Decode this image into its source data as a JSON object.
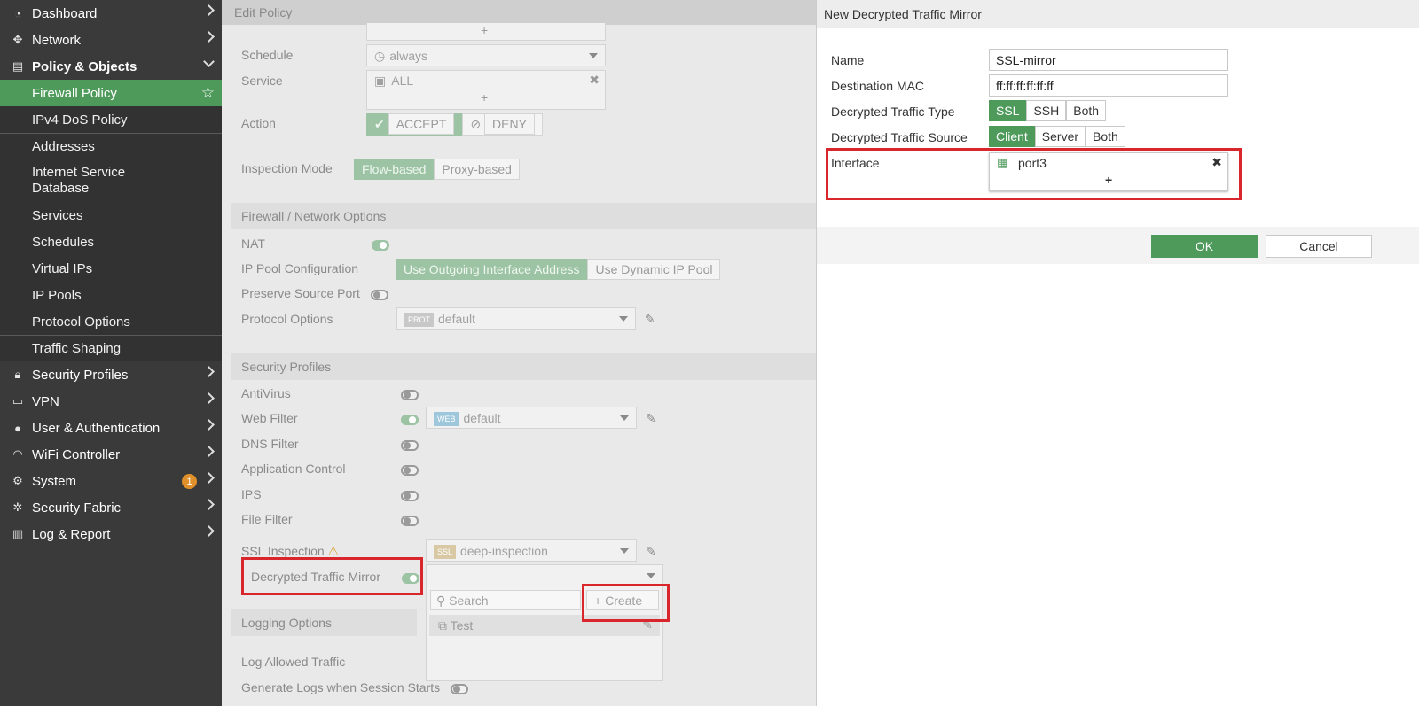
{
  "sidebar": {
    "items": [
      {
        "label": "Dashboard",
        "icon": "dashboard-icon"
      },
      {
        "label": "Network",
        "icon": "network-icon"
      },
      {
        "label": "Policy & Objects",
        "icon": "policy-icon"
      },
      {
        "label": "Security Profiles",
        "icon": "lock-icon"
      },
      {
        "label": "VPN",
        "icon": "monitor-icon"
      },
      {
        "label": "User & Authentication",
        "icon": "user-icon"
      },
      {
        "label": "WiFi Controller",
        "icon": "wifi-icon"
      },
      {
        "label": "System",
        "icon": "gear-icon",
        "badge": "1"
      },
      {
        "label": "Security Fabric",
        "icon": "fabric-icon"
      },
      {
        "label": "Log & Report",
        "icon": "chart-icon"
      }
    ],
    "policy_sub": [
      "Firewall Policy",
      "IPv4 DoS Policy",
      "Addresses",
      "Internet Service Database",
      "Services",
      "Schedules",
      "Virtual IPs",
      "IP Pools",
      "Protocol Options",
      "Traffic Shaping"
    ]
  },
  "edit": {
    "title": "Edit Policy",
    "schedule_label": "Schedule",
    "schedule_value": "always",
    "service_label": "Service",
    "service_value": "ALL",
    "action_label": "Action",
    "accept": "ACCEPT",
    "deny": "DENY",
    "inspection_label": "Inspection Mode",
    "flow": "Flow-based",
    "proxy": "Proxy-based",
    "fw_section": "Firewall / Network Options",
    "nat": "NAT",
    "ippool_label": "IP Pool Configuration",
    "ippool_out": "Use Outgoing Interface Address",
    "ippool_dyn": "Use Dynamic IP Pool",
    "preserve": "Preserve Source Port",
    "proto_label": "Protocol Options",
    "proto_tag": "PROT",
    "proto_value": "default",
    "sec_section": "Security Profiles",
    "antivirus": "AntiVirus",
    "webfilter": "Web Filter",
    "web_tag": "WEB",
    "web_value": "default",
    "dnsfilter": "DNS Filter",
    "appctrl": "Application Control",
    "ips": "IPS",
    "filefilter": "File Filter",
    "sslinsp": "SSL Inspection",
    "ssl_tag": "SSL",
    "ssl_value": "deep-inspection",
    "dtm": "Decrypted Traffic Mirror",
    "search_placeholder": "Search",
    "create": "Create",
    "test_entry": "Test",
    "log_section": "Logging Options",
    "log_allowed": "Log Allowed Traffic",
    "gen_logs": "Generate Logs when Session Starts"
  },
  "dialog": {
    "title": "New Decrypted Traffic Mirror",
    "name_label": "Name",
    "name_value": "SSL-mirror",
    "mac_label": "Destination MAC",
    "mac_value": "ff:ff:ff:ff:ff:ff",
    "type_label": "Decrypted Traffic Type",
    "type_opts": [
      "SSL",
      "SSH",
      "Both"
    ],
    "source_label": "Decrypted Traffic Source",
    "source_opts": [
      "Client",
      "Server",
      "Both"
    ],
    "iface_label": "Interface",
    "iface_value": "port3",
    "ok": "OK",
    "cancel": "Cancel"
  }
}
